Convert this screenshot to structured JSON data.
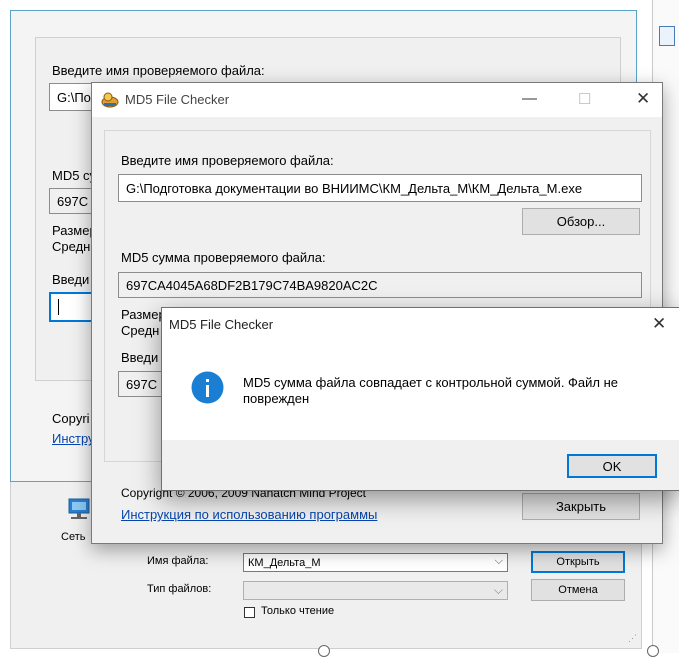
{
  "back_window": {
    "file_label": "Введите имя проверяемого файла:",
    "file_value": "G:\\По",
    "md5_label": "MD5 су",
    "md5_value": "697C",
    "size_label": "Размер",
    "avg_label": "Средн",
    "enter_label": "Введи",
    "copyright": "Copyri",
    "instr_link": "Инстру"
  },
  "main_window": {
    "title": "MD5 File Checker",
    "file_label": "Введите имя проверяемого файла:",
    "file_value": "G:\\Подготовка документации во ВНИИМС\\КМ_Дельта_М\\КМ_Дельта_М.exe",
    "browse_button": "Обзор...",
    "md5_label": "MD5 сумма проверяемого файла:",
    "md5_value": "697CA4045A68DF2B179C74BA9820AC2C",
    "size_label": "Размер",
    "avg_label": "Средн",
    "enter_label": "Введи",
    "enter_value": "697C",
    "copyright": "Copyright © 2006, 2009 Nahatch Mind Project",
    "instr_link": "Инструкция по использованию программы",
    "close_button": "Закрыть"
  },
  "message_box": {
    "title": "MD5 File Checker",
    "message": "MD5 сумма файла совпадает с контрольной суммой. Файл не поврежден",
    "ok_button": "OK",
    "info_icon": "information-icon"
  },
  "file_dialog": {
    "sidebar_network": "Сеть",
    "filename_label": "Имя файла:",
    "filename_value": "КМ_Дельта_М",
    "filetype_label": "Тип файлов:",
    "readonly_label": "Только чтение",
    "open_button": "Открыть",
    "cancel_button": "Отмена"
  },
  "colors": {
    "accent": "#0078d7",
    "info": "#1a7fd3",
    "link": "#0645ad",
    "frame": "#5aa3c9"
  }
}
